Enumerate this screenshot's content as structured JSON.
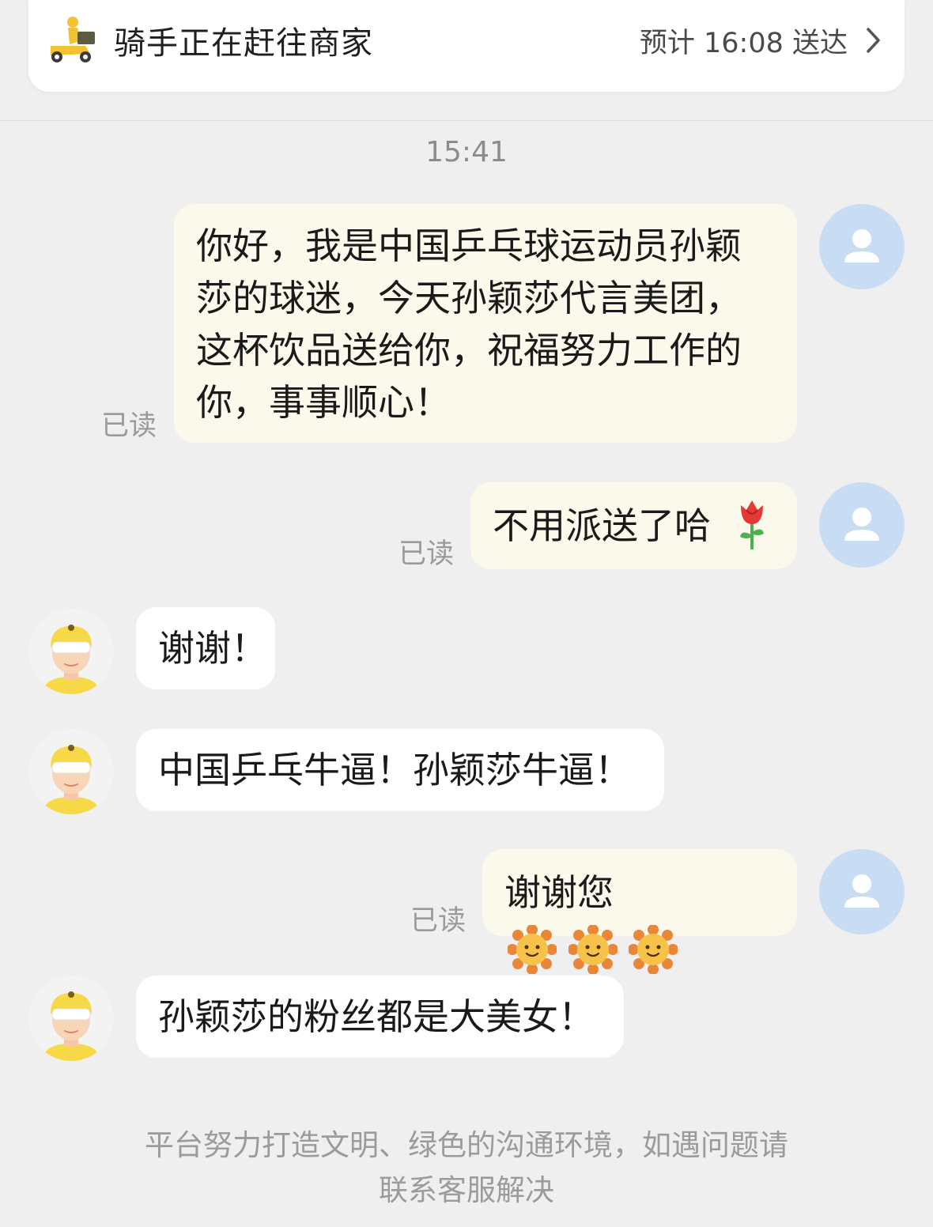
{
  "header": {
    "status_title": "骑手正在赶往商家",
    "eta": "预计 16:08 送达",
    "rider_icon": "delivery-scooter-icon",
    "chevron_icon": "chevron-right-icon"
  },
  "chat": {
    "timestamp": "15:41",
    "read_label": "已读",
    "messages": [
      {
        "from": "me",
        "lines": [
          "你好，我是中国乒乓球运动员孙颖",
          "莎的球迷，今天孙颖莎代言美团，",
          "这杯饮品送给你，祝福努力工作的",
          "你，事事顺心！"
        ],
        "read": true
      },
      {
        "from": "me",
        "text": "不用派送了哈",
        "emoji": "rose",
        "read": true
      },
      {
        "from": "rider",
        "text": "谢谢！"
      },
      {
        "from": "rider",
        "text": "中国乒乓牛逼！孙颖莎牛逼！"
      },
      {
        "from": "me",
        "text": "谢谢您",
        "emoji": "sun-face x3",
        "read": true
      },
      {
        "from": "rider",
        "text": "孙颖莎的粉丝都是大美女！"
      }
    ]
  },
  "footer": {
    "line1": "平台努力打造文明、绿色的沟通环境，如遇问题请",
    "line2": "联系客服解决"
  },
  "colors": {
    "background": "#efefef",
    "my_bubble": "#fbf8ec",
    "their_bubble": "#ffffff",
    "user_avatar": "#c8dcf3",
    "rider_yellow": "#f7d947"
  }
}
